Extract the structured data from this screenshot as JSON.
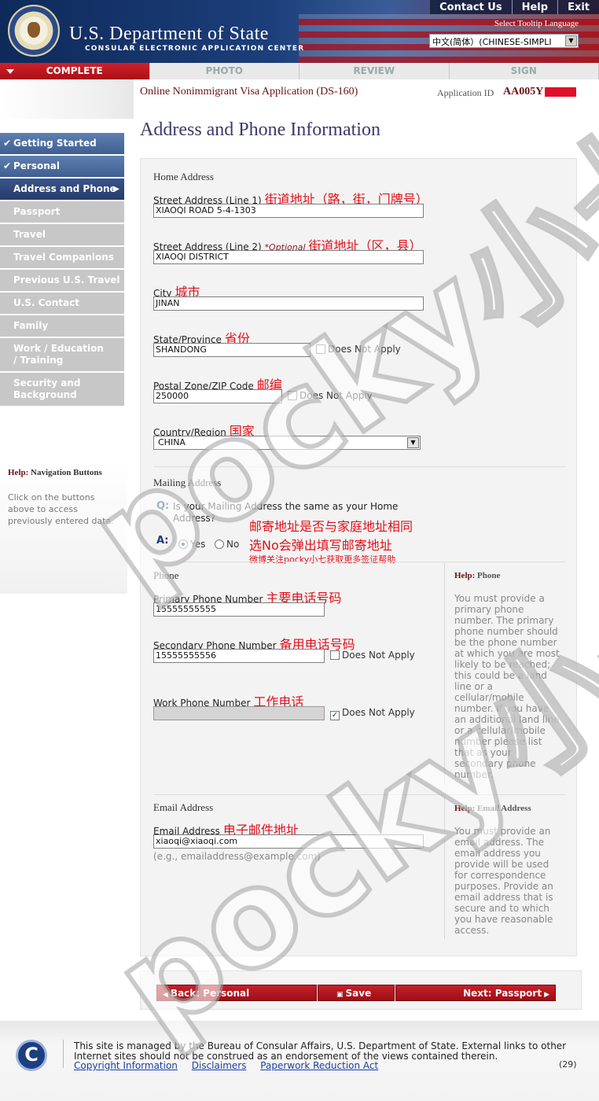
{
  "header": {
    "dept_title": "U.S. Department of State",
    "subtitle": "CONSULAR ELECTRONIC APPLICATION CENTER",
    "links": [
      "Contact Us",
      "Help",
      "Exit"
    ],
    "tooltip_label": "Select Tooltip Language",
    "tooltip_language": "中文(简体）(CHINESE-SIMPLI"
  },
  "progress": {
    "steps": [
      "COMPLETE",
      "PHOTO",
      "REVIEW",
      "SIGN"
    ],
    "active_color": "#c41a23"
  },
  "form": {
    "title": "Online Nonimmigrant Visa Application (DS-160)",
    "app_id_label": "Application ID",
    "app_id": "AA005Y"
  },
  "page_title": "Address and Phone Information",
  "sidebar": {
    "items": [
      {
        "label": "Getting Started",
        "state": "done"
      },
      {
        "label": "Personal",
        "state": "done"
      },
      {
        "label": "Address and Phone",
        "state": "current"
      },
      {
        "label": "Passport",
        "state": "pending"
      },
      {
        "label": "Travel",
        "state": "pending"
      },
      {
        "label": "Travel Companions",
        "state": "pending"
      },
      {
        "label": "Previous U.S. Travel",
        "state": "pending"
      },
      {
        "label": "U.S. Contact",
        "state": "pending"
      },
      {
        "label": "Family",
        "state": "pending"
      },
      {
        "label": "Work / Education / Training",
        "state": "pending"
      },
      {
        "label": "Security and Background",
        "state": "pending"
      }
    ],
    "help_title_bold": "Help:",
    "help_title": "Navigation Buttons",
    "help_text": "Click on the buttons above to access previously entered data."
  },
  "home": {
    "heading": "Home Address",
    "street1_label": "Street Address (Line 1)",
    "street1_note": "街道地址（路，街，门牌号）",
    "street1_value": "XIAOQI ROAD 5-4-1303",
    "street2_label": "Street Address (Line 2)",
    "street2_optional": "*Optional",
    "street2_note": "街道地址（区，县）",
    "street2_value": "XIAOQI DISTRICT",
    "city_label": "City",
    "city_note": "城市",
    "city_value": "JINAN",
    "state_label": "State/Province",
    "state_note": "省份",
    "state_value": "SHANDONG",
    "postal_label": "Postal Zone/ZIP Code",
    "postal_note": "邮编",
    "postal_value": "250000",
    "country_label": "Country/Region",
    "country_note": "国家",
    "country_value": "CHINA",
    "does_not_apply": "Does Not Apply"
  },
  "mailing": {
    "heading": "Mailing Address",
    "q_marker": "Q:",
    "question": "Is your Mailing Address the same as your Home Address?",
    "a_marker": "A:",
    "yes": "Yes",
    "no": "No",
    "selected": "Yes",
    "note1": "邮寄地址是否与家庭地址相同",
    "note2": "选No会弹出填写邮寄地址",
    "note3": "微博关注pocky小七获取更多签证帮助"
  },
  "phone": {
    "heading": "Phone",
    "primary_label": "Primary Phone Number",
    "primary_note": "主要电话号码",
    "primary_value": "15555555555",
    "secondary_label": "Secondary Phone Number",
    "secondary_note": "备用电话号码",
    "secondary_value": "15555555556",
    "work_label": "Work Phone Number",
    "work_note": "工作电话",
    "work_value": "",
    "does_not_apply": "Does Not Apply",
    "help_bold": "Help:",
    "help_title": "Phone",
    "help_text": "You must provide a primary phone number. The primary phone number should be the phone number at which you are most likely to be reached; this could be a land line or a cellular/mobile number. If you have an additional land line or a cellular/mobile number please list that as your secondary phone number."
  },
  "email": {
    "heading": "Email Address",
    "label": "Email Address",
    "note": "电子邮件地址",
    "value": "xiaoqi@xiaoqi.com",
    "example": "(e.g., emailaddress@example.com)",
    "help_bold": "Help:",
    "help_title": "Email Address",
    "help_text": "You must provide an email address. The email address you provide will be used for correspondence purposes. Provide an email address that is secure and to which you have reasonable access."
  },
  "buttons": {
    "back": "Back: Personal",
    "save": "Save",
    "next": "Next: Passport"
  },
  "footer": {
    "logo": "C",
    "text": "This site is managed by the Bureau of Consular Affairs, U.S. Department of State. External links to other Internet sites should not be construed as an endorsement of the views contained therein.",
    "links": [
      "Copyright Information",
      "Disclaimers",
      "Paperwork Reduction Act"
    ],
    "page_num": "(29)"
  },
  "watermark": "pocky小七"
}
